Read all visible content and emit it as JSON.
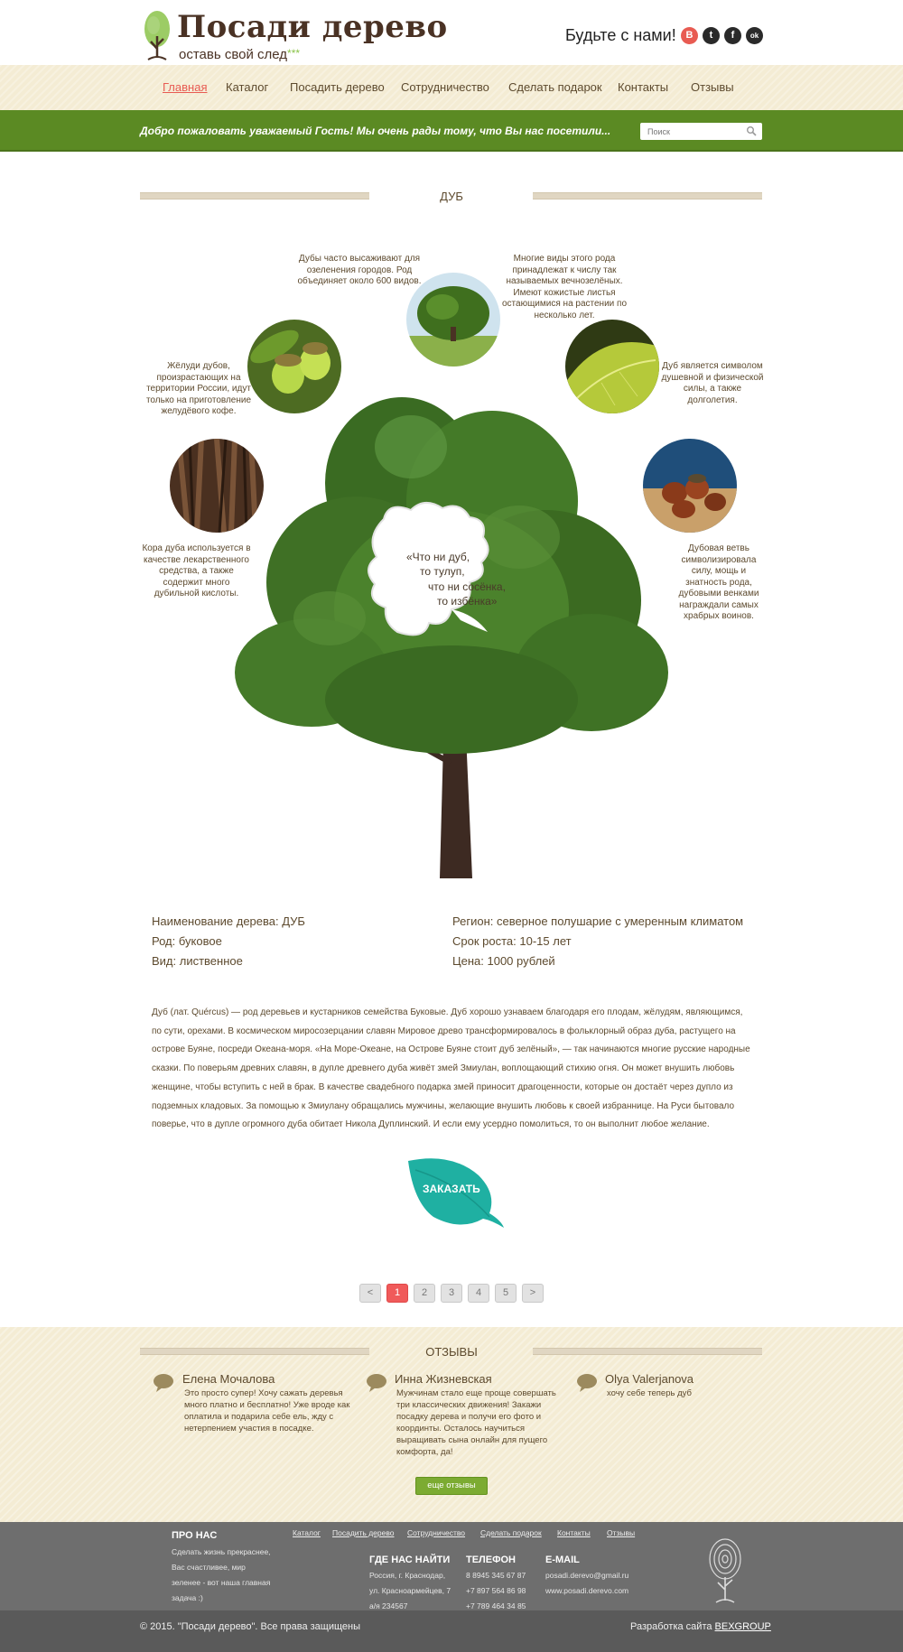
{
  "header": {
    "logo_title": "Посади дерево",
    "logo_subtitle": "оставь свой след",
    "logo_stars": "***",
    "join_text": "Будьте с нами!",
    "social": [
      {
        "icon": "vk-icon",
        "glyph": "В",
        "color": "#e85b52"
      },
      {
        "icon": "twitter-icon",
        "glyph": "t",
        "color": "#2a2a2a"
      },
      {
        "icon": "facebook-icon",
        "glyph": "f",
        "color": "#2a2a2a"
      },
      {
        "icon": "odnoklassniki-icon",
        "glyph": "ok",
        "color": "#2a2a2a"
      }
    ]
  },
  "nav": {
    "items": [
      "Главная",
      "Каталог",
      "Посадить дерево",
      "Сотрудничество",
      "Сделать подарок",
      "Контакты",
      "Отзывы"
    ],
    "active": "Главная"
  },
  "welcome": {
    "text": "Добро пожаловать уважаемый Гость!  Мы очень рады тому, что Вы нас посетили...",
    "search_placeholder": "Поиск"
  },
  "tree_section": {
    "title": "ДУБ",
    "facts": [
      "Дубы часто высаживают для озеленения городов. Род объединяет около 600 видов.",
      "Многие виды этого рода принадлежат к числу так называемых вечнозелёных. Имеют кожистые листья остающимися на растении по несколько лет.",
      "Жёлуди дубов, произрастающих на территории России, идут только на приготовление желудёвого кофе.",
      "Дуб является символом душевной и физической силы, а также долголетия.",
      "Кора дуба используется в качестве лекарственного средства, а также содержит много дубильной кислоты.",
      "Дубовая ветвь символизировала силу, мощь и знатность рода, дубовыми венками награждали самых храбрых воинов."
    ],
    "quote_lines": [
      "«Что ни дуб,",
      "то тулуп,",
      "что ни сосёнка,",
      "то избёнка»"
    ]
  },
  "info": {
    "name_label": "Наименование дерева:  ДУБ",
    "family": "Род: буковое",
    "type": "Вид: лиственное",
    "region": "Регион: северное полушарие с умеренным климатом",
    "growth": "Срок роста: 10-15 лет",
    "price": "Цена: 1000 рублей"
  },
  "description": "Дуб (лат. Quércus) — род деревьев и кустарников семейства Буковые.  Дуб хорошо узнаваем благодаря его плодам, жёлудям, являющимся, по сути, орехами. В космическом миросозерцании славян Мировое древо трансформировалось в фольклорный образ дуба, растущего на острове Буяне, посреди Океана-моря. «На Море-Океане, на Острове Буяне стоит дуб зелёный», — так начинаются многие русские народные сказки. По поверьям древних славян, в дупле древнего дуба живёт змей Змиулан, воплощающий стихию огня. Он может внушить любовь женщине, чтобы вступить с ней в брак. В качестве свадебного подарка змей приносит драгоценности, которые он достаёт через дупло из подземных кладовых. За помощью к Змиулану обращались мужчины, желающие внушить любовь к своей избраннице. На Руси бытовало поверье, что в дупле огромного дуба обитает Никола Дуплинский. И если ему усердно помолиться, то он выполнит любое желание.",
  "order_button": "ЗАКАЗАТЬ",
  "pagination": {
    "prev": "<",
    "next": ">",
    "pages": [
      "1",
      "2",
      "3",
      "4",
      "5"
    ],
    "current": "1"
  },
  "reviews": {
    "title": "ОТЗЫВЫ",
    "items": [
      {
        "name": "Елена Мочалова",
        "text": "Это просто супер! Хочу сажать деревья много платно и бесплатно! Уже вроде как оплатила и подарила себе ель, жду с нетерпением участия в посадке."
      },
      {
        "name": "Инна Жизневская",
        "text": "Мужчинам стало еще проще совершать три классических движения! Закажи посадку дерева и получи его фото и координты. Осталось научиться выращивать сына онлайн для пущего комфорта, да!"
      },
      {
        "name": "Olya Valerjanova",
        "text": "хочу себе теперь дуб"
      }
    ],
    "more_button": "еще отзывы"
  },
  "footer": {
    "links": [
      "Каталог",
      "Посадить дерево",
      "Сотрудничество",
      "Сделать подарок",
      "Контакты",
      "Отзывы"
    ],
    "about_title": "ПРО НАС",
    "about_lines": [
      "Сделать жизнь прекраснее,",
      "Вас счастливее, мир",
      "зеленее - вот наша главная",
      "задача :)"
    ],
    "where_title": "ГДЕ НАС НАЙТИ",
    "where_lines": [
      "Россия, г. Краснодар,",
      "ул. Красноармейцев, 7",
      "а/я 234567"
    ],
    "phone_title": "ТЕЛЕФОН",
    "phone_lines": [
      "8 8945 345 67 87",
      "+7 897 564 86 98",
      "+7 789 464 34 85"
    ],
    "email_title": "E-MAIL",
    "email_lines": [
      "posadi.derevo@gmail.ru",
      "www.posadi.derevo.com"
    ],
    "copyright": "© 2015. \"Посади дерево\". Все права защищены",
    "dev_prefix": "Разработка сайта ",
    "dev_link": "BEXGROUP"
  }
}
